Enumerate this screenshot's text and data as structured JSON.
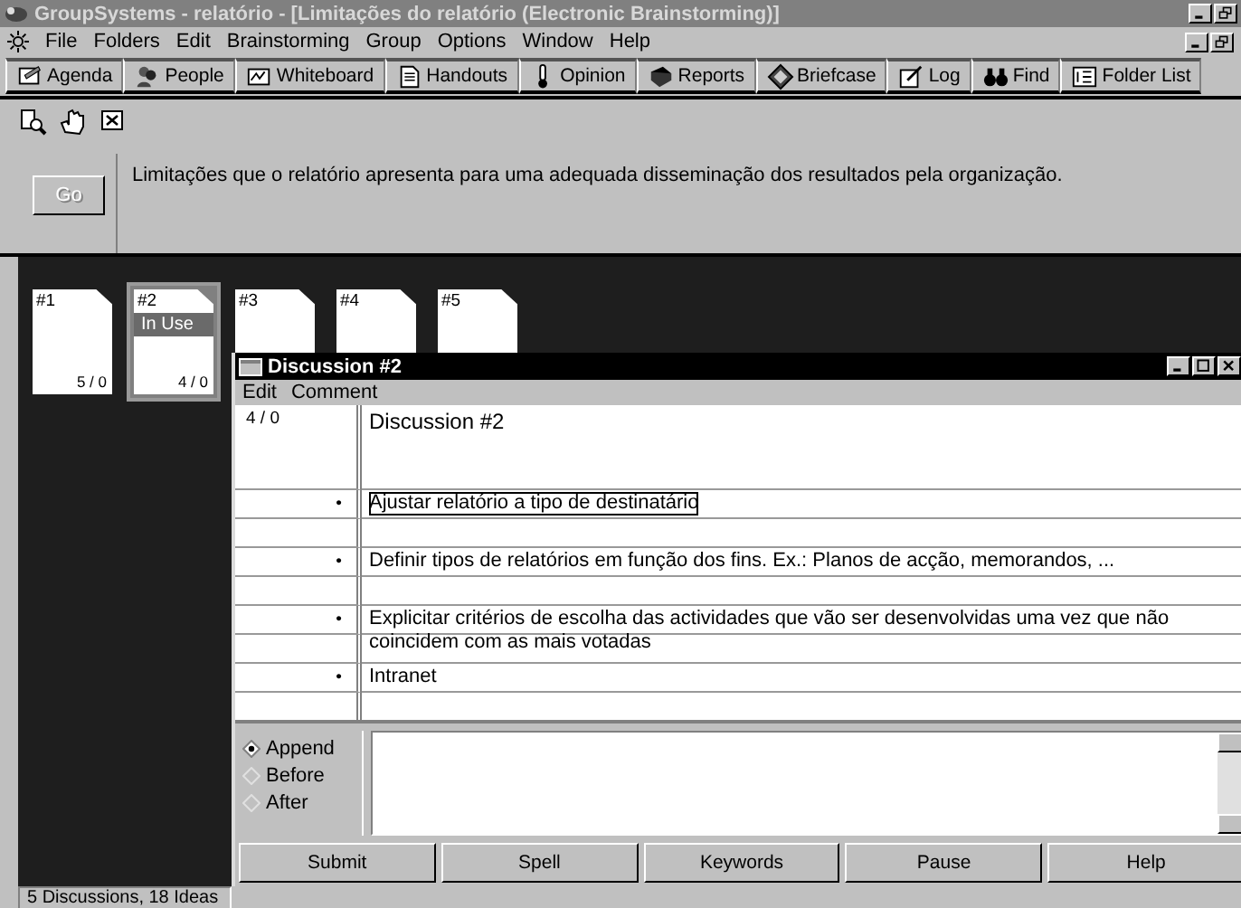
{
  "window": {
    "title": "GroupSystems - relatório - [Limitações do relatório (Electronic Brainstorming)]"
  },
  "menu": [
    "File",
    "Folders",
    "Edit",
    "Brainstorming",
    "Group",
    "Options",
    "Window",
    "Help"
  ],
  "toolbar": [
    "Agenda",
    "People",
    "Whiteboard",
    "Handouts",
    "Opinion",
    "Reports",
    "Briefcase",
    "Log",
    "Find",
    "Folder List"
  ],
  "topic": {
    "button": "Go",
    "disabled": true,
    "text": "Limitações que o relatório apresenta para uma adequada disseminação dos resultados pela organização."
  },
  "discussions": [
    {
      "label": "#1",
      "count": "5 / 0",
      "selected": false
    },
    {
      "label": "#2",
      "count": "4 / 0",
      "selected": true,
      "status": "In Use"
    },
    {
      "label": "#3",
      "selected": false
    },
    {
      "label": "#4",
      "selected": false
    },
    {
      "label": "#5",
      "selected": false
    }
  ],
  "discussion_window": {
    "title": "Discussion #2",
    "menu": [
      "Edit",
      "Comment"
    ],
    "header": {
      "count": "4 / 0",
      "title": "Discussion #2"
    },
    "rows": [
      {
        "kind": "idea",
        "bullet": "•",
        "text": "Ajustar relatório a tipo de destinatário",
        "focused": true
      },
      {
        "kind": "blank"
      },
      {
        "kind": "idea",
        "bullet": "•",
        "text": "Definir tipos de relatórios em função dos fins. Ex.: Planos de acção, memorandos, ...",
        "focused": false
      },
      {
        "kind": "blank"
      },
      {
        "kind": "idea",
        "bullet": "•",
        "text": "Explicitar critérios de escolha das actividades que vão ser desenvolvidas uma vez que não coincidem com as mais votadas",
        "focused": false
      },
      {
        "kind": "blank"
      },
      {
        "kind": "idea",
        "bullet": "•",
        "text": "Intranet",
        "focused": false
      },
      {
        "kind": "blank"
      }
    ],
    "placement": [
      {
        "label": "Append",
        "selected": true
      },
      {
        "label": "Before",
        "selected": false
      },
      {
        "label": "After",
        "selected": false
      }
    ],
    "buttons": [
      "Submit",
      "Spell",
      "Keywords",
      "Pause",
      "Help"
    ]
  },
  "status_bar": "5 Discussions, 18 Ideas"
}
